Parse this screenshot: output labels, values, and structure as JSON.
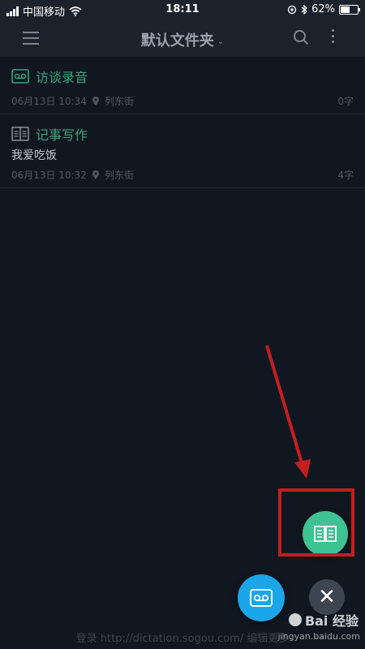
{
  "status_bar": {
    "carrier": "中国移动",
    "time": "18:11",
    "battery": "62%",
    "battery_level": 0.62
  },
  "header": {
    "title": "默认文件夹",
    "caret": "⌄"
  },
  "notes": [
    {
      "title": "访谈录音",
      "content": "",
      "date": "06月13日 10:34",
      "location": "列东街",
      "count": "0字"
    },
    {
      "title": "记事写作",
      "content": "我爱吃饭",
      "date": "06月13日 10:32",
      "location": "列东街",
      "count": "4字"
    }
  ],
  "fab": {
    "close_symbol": "✕"
  },
  "footer": {
    "text": "登录 http://dictation.sogou.com/ 编辑更多"
  },
  "watermark": {
    "brand": "Bai 经验",
    "url": "jingyan.baidu.com"
  },
  "colors": {
    "background": "#111720",
    "accent_green": "#3ec193",
    "accent_blue": "#1aa6e8",
    "annotation_red": "#c41e1e"
  }
}
